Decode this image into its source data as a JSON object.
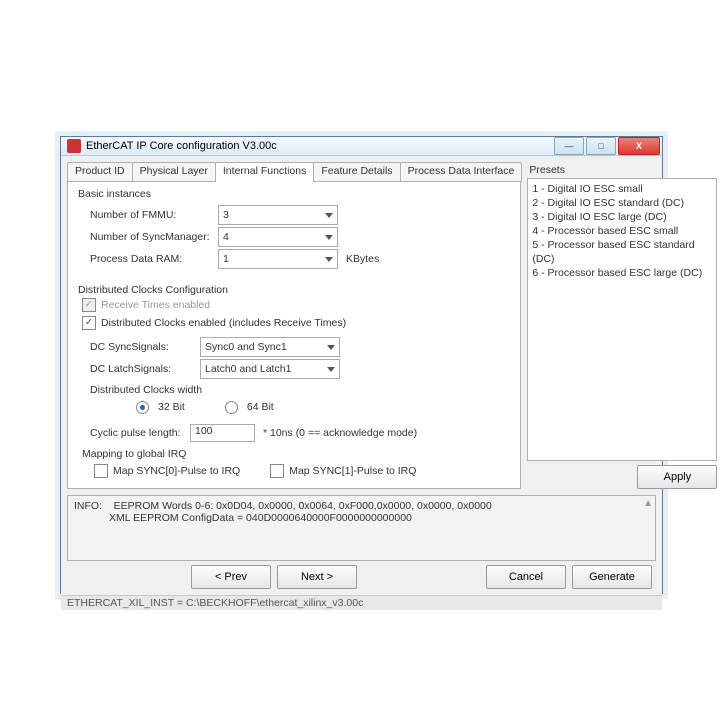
{
  "window": {
    "title": "EtherCAT IP Core configuration V3.00c"
  },
  "tabs": [
    "Product ID",
    "Physical Layer",
    "Internal Functions",
    "Feature Details",
    "Process Data Interface"
  ],
  "basic": {
    "title": "Basic instances",
    "fmmu_lbl": "Number of FMMU:",
    "fmmu_val": "3",
    "sync_lbl": "Number of SyncManager:",
    "sync_val": "4",
    "ram_lbl": "Process Data RAM:",
    "ram_val": "1",
    "ram_unit": "KBytes"
  },
  "dcc": {
    "title": "Distributed Clocks Configuration",
    "rx_lbl": "Receive Times enabled",
    "dc_en_lbl": "Distributed Clocks enabled (includes Receive Times)",
    "syncsig_lbl": "DC SyncSignals:",
    "syncsig_val": "Sync0 and Sync1",
    "latchsig_lbl": "DC LatchSignals:",
    "latchsig_val": "Latch0 and Latch1",
    "width_title": "Distributed Clocks width",
    "w32": "32 Bit",
    "w64": "64 Bit",
    "cyc_lbl": "Cyclic pulse length:",
    "cyc_val": "100",
    "cyc_unit": "* 10ns  (0 == acknowledge mode)",
    "map_title": "Mapping to global IRQ",
    "map0": "Map SYNC[0]-Pulse to IRQ",
    "map1": "Map SYNC[1]-Pulse to IRQ"
  },
  "presets": {
    "title": "Presets",
    "items": [
      "1 - Digital IO ESC small",
      "2 - Digital IO ESC standard (DC)",
      "3 - Digital IO ESC large (DC)",
      "4 - Processor based ESC small",
      "5 - Processor based ESC standard (DC)",
      "6 - Processor based ESC large (DC)"
    ],
    "apply": "Apply"
  },
  "info": {
    "pre": "INFO:",
    "l1": "EEPROM Words 0-6: 0x0D04, 0x0000, 0x0064, 0xF000,0x0000, 0x0000, 0x0000",
    "l2": "XML EEPROM ConfigData = 040D0000640000F0000000000000"
  },
  "nav": {
    "prev": "< Prev",
    "next": "Next >",
    "cancel": "Cancel",
    "generate": "Generate"
  },
  "status": "ETHERCAT_XIL_INST = C:\\BECKHOFF\\ethercat_xilinx_v3.00c"
}
